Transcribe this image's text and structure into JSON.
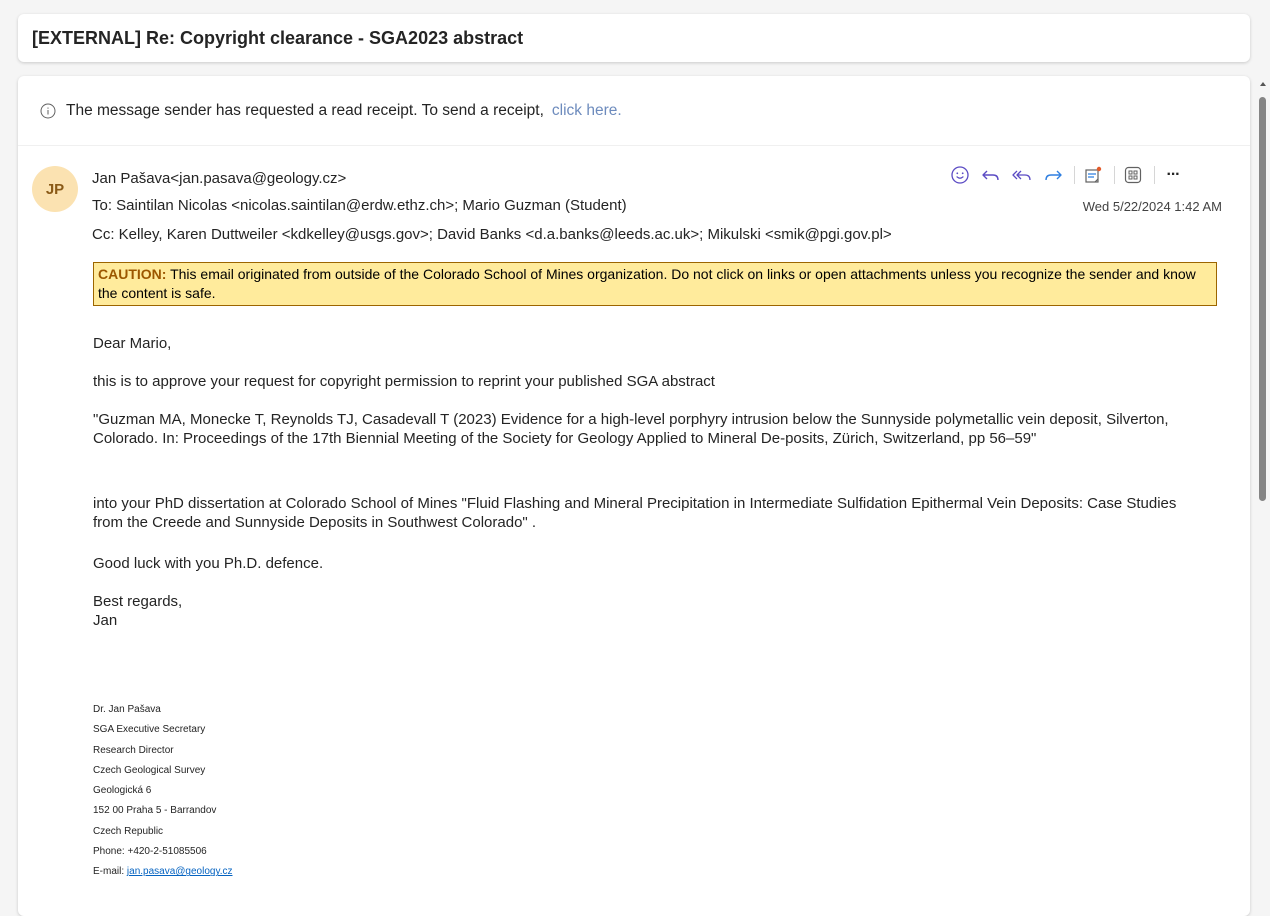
{
  "subject": "[EXTERNAL] Re: Copyright clearance - SGA2023 abstract",
  "receipt": {
    "message": "The message sender has requested a read receipt. To send a receipt,",
    "link": "click here."
  },
  "sender": {
    "initials": "JP",
    "from": "Jan Pašava<jan.pasava@geology.cz>",
    "to": "To:  Saintilan Nicolas <nicolas.saintilan@erdw.ethz.ch>;  Mario Guzman (Student)",
    "cc": "Cc:  Kelley, Karen Duttweiler <kdkelley@usgs.gov>;  David Banks <d.a.banks@leeds.ac.uk>;  Mikulski <smik@pgi.gov.pl>",
    "date": "Wed 5/22/2024 1:42 AM"
  },
  "toolbar": {
    "icons": [
      "emoji-icon",
      "reply-icon",
      "reply-all-icon",
      "forward-icon",
      "sticky-note-icon",
      "apps-icon",
      "more-icon"
    ],
    "more_label": "···"
  },
  "caution": {
    "label": "CAUTION:",
    "text": " This email originated from outside of the Colorado School of Mines organization. Do not click on links or open attachments unless you recognize the sender and know the content is safe."
  },
  "body": {
    "greeting": "Dear Mario,",
    "p1": "this is to approve your request for copyright permission to reprint your published SGA abstract",
    "p2": "\"Guzman MA, Monecke T, Reynolds TJ, Casadevall T (2023) Evidence for a high-level porphyry intrusion below the Sunnyside polymetallic vein deposit, Silverton, Colorado. In: Proceedings of the 17th Biennial Meeting of the Society for Geology Applied to Mineral De-posits, Zürich, Switzerland, pp 56–59\"",
    "p3": "into your PhD dissertation at Colorado School of Mines \"Fluid Flashing and Mineral Precipitation in Intermediate Sulfidation Epithermal Vein Deposits: Case Studies from the Creede and Sunnyside Deposits in Southwest Colorado\" .",
    "p4": "Good luck with you Ph.D. defence.",
    "closing": "Best regards,",
    "name": "Jan"
  },
  "signature": {
    "lines": [
      "Dr. Jan Pašava",
      "SGA Executive Secretary",
      "Research Director",
      "Czech Geological Survey",
      "Geologická 6",
      "152 00 Praha 5 - Barrandov",
      "Czech Republic",
      "Phone: +420-2-51085506"
    ],
    "email_label": "E-mail: ",
    "email": "jan.pasava@geology.cz"
  },
  "colors": {
    "avatar_bg": "#fbe2b1",
    "avatar_text": "#8a5a17",
    "toolbar_accent": "#5b4bc4",
    "forward_accent": "#2f7fe0",
    "caution_bg": "#ffeb9c",
    "link": "#6d8bbd"
  }
}
